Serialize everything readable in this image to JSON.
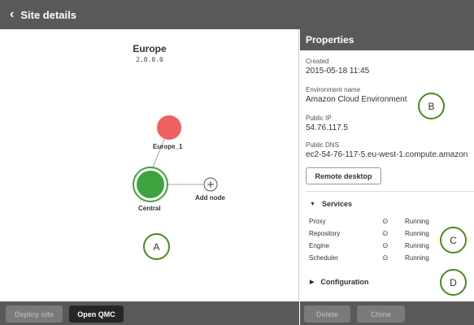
{
  "header": {
    "back_label": "Site details",
    "back_icon": "chevron-left-icon"
  },
  "site": {
    "name": "Europe",
    "version": "2.0.0.0",
    "nodes": [
      {
        "label": "Europe_1",
        "color": "#f06060",
        "role": "node"
      },
      {
        "label": "Central",
        "color": "#3ea33e",
        "role": "central"
      }
    ],
    "add_node_label": "Add node"
  },
  "callouts": {
    "a": "A",
    "b": "B",
    "c": "C",
    "d": "D"
  },
  "properties": {
    "title": "Properties",
    "created_label": "Created",
    "created_value": "2015-05-18 11:45",
    "env_label": "Environment name",
    "env_value": "Amazon Cloud Environment",
    "ip_label": "Public IP",
    "ip_value": "54.76.117.5",
    "dns_label": "Public DNS",
    "dns_value": "ec2-54-76-117-5.eu-west-1.compute.amazon",
    "remote_desktop_label": "Remote desktop"
  },
  "services": {
    "title": "Services",
    "rows": [
      {
        "name": "Proxy",
        "status": "Running"
      },
      {
        "name": "Repository",
        "status": "Running"
      },
      {
        "name": "Engine",
        "status": "Running"
      },
      {
        "name": "Scheduler",
        "status": "Running"
      }
    ]
  },
  "configuration": {
    "title": "Configuration"
  },
  "footer": {
    "deploy_label": "Deploy site",
    "open_qmc_label": "Open QMC",
    "delete_label": "Delete",
    "clone_label": "Clone"
  },
  "colors": {
    "bar": "#595959",
    "accent_green": "#4a8a1d",
    "node_red": "#f06060",
    "node_green": "#3ea33e"
  }
}
